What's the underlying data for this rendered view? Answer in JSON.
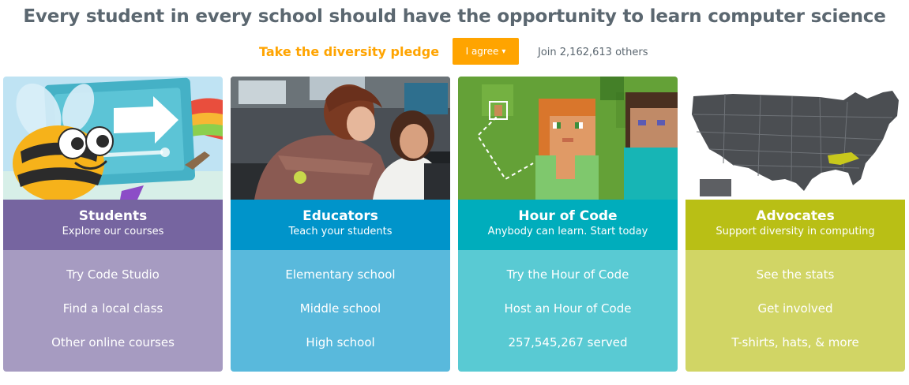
{
  "header": {
    "headline": "Every student in every school should have the opportunity to learn computer science"
  },
  "pledge": {
    "link_text": "Take the diversity pledge",
    "button_label": "I agree",
    "join_text": "Join 2,162,613 others"
  },
  "colors": {
    "orange": "#ffa400",
    "students": "#7665a0",
    "educators": "#0094ca",
    "hour_of_code": "#00adbc",
    "advocates": "#b9bf15"
  },
  "cards": [
    {
      "title": "Students",
      "subtitle": "Explore our courses",
      "image_icon": "bee-mascot",
      "links": [
        "Try Code Studio",
        "Find a local class",
        "Other online courses"
      ]
    },
    {
      "title": "Educators",
      "subtitle": "Teach your students",
      "image_icon": "teacher-with-student",
      "links": [
        "Elementary school",
        "Middle school",
        "High school"
      ]
    },
    {
      "title": "Hour of Code",
      "subtitle": "Anybody can learn. Start today",
      "image_icon": "minecraft-characters",
      "links": [
        "Try the Hour of Code",
        "Host an Hour of Code",
        "257,545,267 served"
      ]
    },
    {
      "title": "Advocates",
      "subtitle": "Support diversity in computing",
      "image_icon": "us-map",
      "links": [
        "See the stats",
        "Get involved",
        "T-shirts, hats, & more"
      ]
    }
  ]
}
